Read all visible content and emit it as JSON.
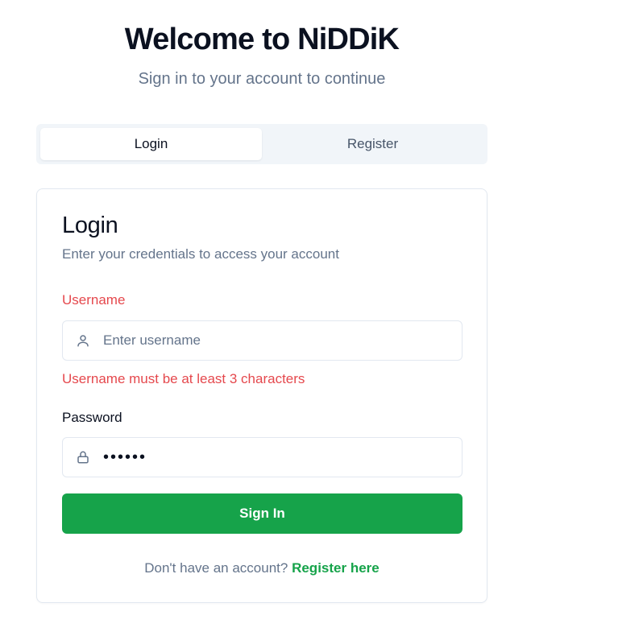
{
  "header": {
    "title": "Welcome to NiDDiK",
    "subtitle": "Sign in to your account to continue"
  },
  "tabs": [
    {
      "label": "Login",
      "active": true
    },
    {
      "label": "Register",
      "active": false
    }
  ],
  "login_card": {
    "title": "Login",
    "description": "Enter your credentials to access your account",
    "username": {
      "label": "Username",
      "placeholder": "Enter username",
      "value": "",
      "icon": "user-icon",
      "error": "Username must be at least 3 characters"
    },
    "password": {
      "label": "Password",
      "value": "••••••",
      "icon": "lock-icon"
    },
    "submit_label": "Sign In",
    "footer_text": "Don't have an account?",
    "footer_link": "Register here"
  },
  "colors": {
    "accent": "#16a34a",
    "error": "#e5484d",
    "muted": "#64748b",
    "tab_bg": "#f1f5f9",
    "border": "#e2e8f0"
  }
}
